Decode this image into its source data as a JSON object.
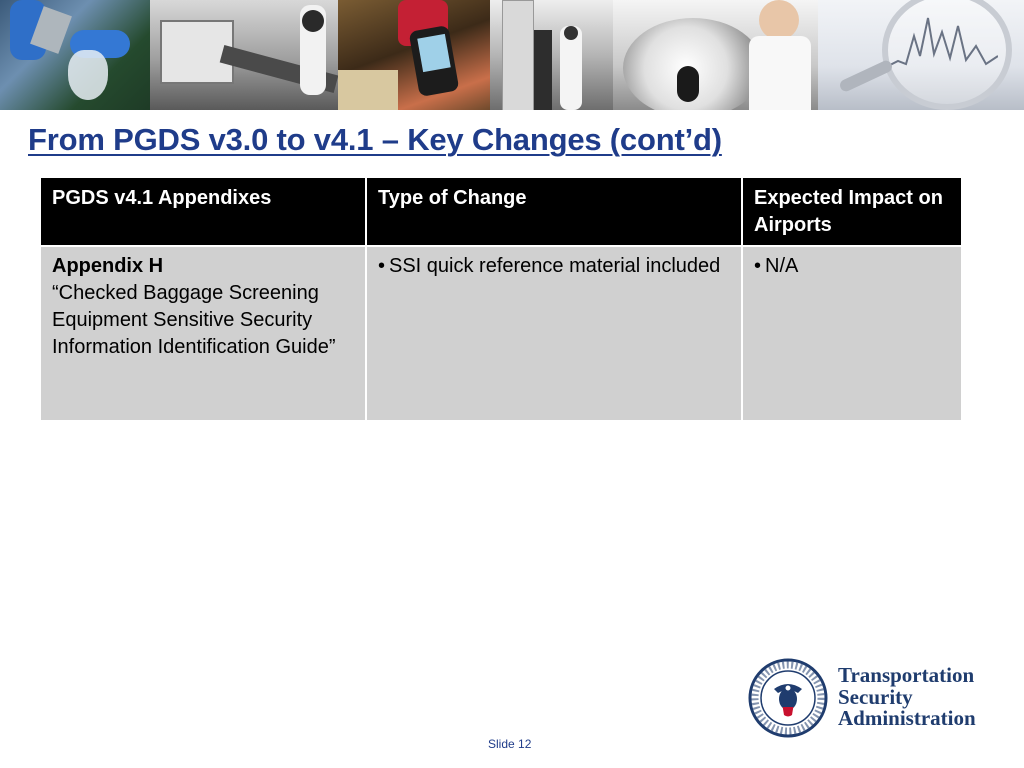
{
  "slide": {
    "title": "From PGDS v3.0 to v4.1 – Key Changes (cont’d)",
    "number_label": "Slide 12"
  },
  "banner": {
    "photos": [
      "screener-with-bag-photo",
      "checkpoint-lane-photo",
      "handheld-device-photo",
      "body-scanner-photo",
      "officer-with-scanner-photo",
      "magnifying-glass-chart-photo"
    ]
  },
  "table": {
    "headers": [
      "PGDS v4.1 Appendixes",
      "Type of Change",
      "Expected Impact on Airports"
    ],
    "rows": [
      {
        "appendix_name": "Appendix H",
        "appendix_title": "“Checked Baggage Screening Equipment Sensitive Security Information Identification Guide”",
        "type_of_change": "SSI quick reference material included",
        "impact": "N/A"
      }
    ]
  },
  "logo": {
    "line1": "Transportation",
    "line2": "Security",
    "line3": "Administration",
    "seal_text": "U.S. DEPARTMENT OF HOMELAND SECURITY"
  },
  "colors": {
    "title": "#1f3c8a",
    "header_bg": "#000000",
    "cell_bg": "#d0d0d0",
    "logo_text": "#1f3c6e"
  }
}
